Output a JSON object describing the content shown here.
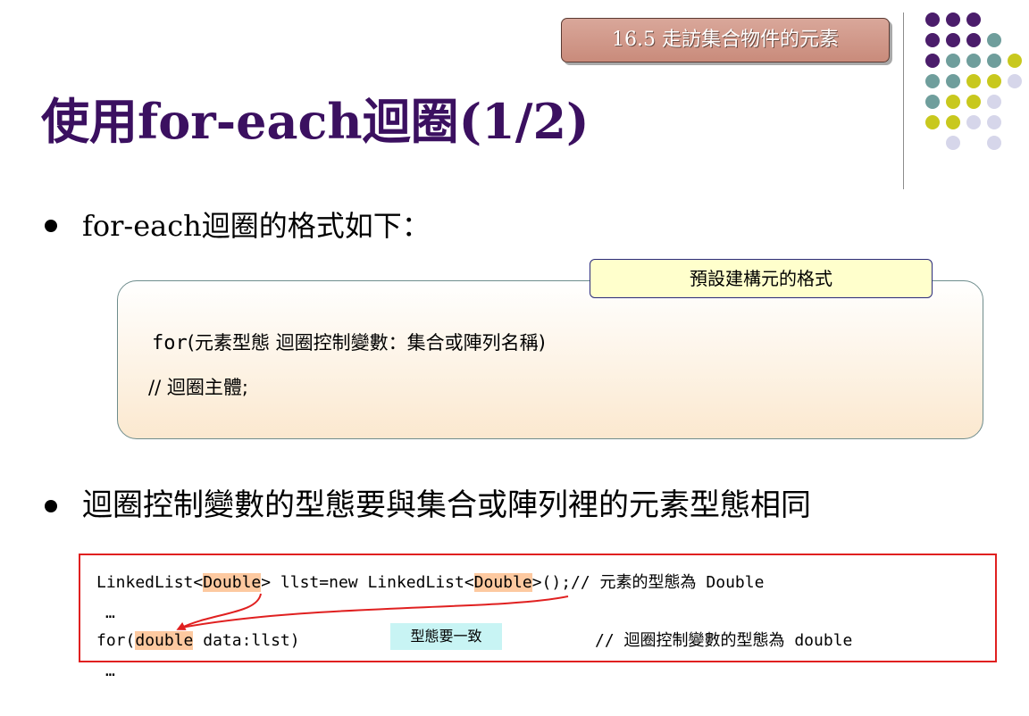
{
  "header": {
    "section_tag": "16.5  走訪集合物件的元素",
    "title": "使用for-each迴圈(1/2)"
  },
  "decor": {
    "dot_colors": {
      "purple": "#4b1d6b",
      "teal": "#6f9e9c",
      "olive": "#c8c81e",
      "lavender": "#d6d6ea"
    }
  },
  "bullets": [
    {
      "text": "for-each迴圈的格式如下："
    },
    {
      "text": "迴圈控制變數的型態要與集合或陣列裡的元素型態相同"
    }
  ],
  "syntax_box": {
    "label": "預設建構元的格式",
    "line1_keyword": "for",
    "line1_rest": "(元素型態 迴圈控制變數：集合或陣列名稱)",
    "line2": "// 迴圈主體;"
  },
  "example": {
    "line1": {
      "a": "LinkedList<",
      "b": "Double",
      "c": "> llst=new LinkedList<",
      "d": "Double",
      "e": ">();// 元素的型態為 Double"
    },
    "ellipsis1": "…",
    "line3": {
      "a": "for(",
      "b": "double",
      "c": " data:llst)",
      "comment": "// 迴圈控制變數的型態為 double"
    },
    "ellipsis2": "…",
    "note": "型態要一致"
  }
}
